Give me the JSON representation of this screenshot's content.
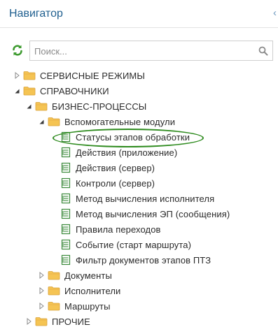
{
  "header": {
    "title": "Навигатор",
    "collapse_icon": "chevron-left-icon"
  },
  "search": {
    "placeholder": "Поиск...",
    "value": ""
  },
  "tree": {
    "servisnye": "СЕРВИСНЫЕ РЕЖИМЫ",
    "spravochniki": "СПРАВОЧНИКИ",
    "biznes": "БИЗНЕС-ПРОЦЕССЫ",
    "vspomog": "Вспомогательные модули",
    "leaves": [
      "Статусы этапов обработки",
      "Действия (приложение)",
      "Действия (сервер)",
      "Контроли (сервер)",
      "Метод вычисления исполнителя",
      "Метод вычисления ЭП (сообщения)",
      "Правила переходов",
      "Событие (старт маршрута)",
      "Фильтр документов этапов ПТЗ"
    ],
    "dokumenty": "Документы",
    "ispolniteli": "Исполнители",
    "marshruty": "Маршруты",
    "prochie": "ПРОЧИЕ"
  },
  "colors": {
    "title": "#1f5f8f",
    "folder": "#f0b94c",
    "doc": "#3c8a3c",
    "refresh": "#3c9a2e",
    "highlight": "#2e8b1e"
  }
}
